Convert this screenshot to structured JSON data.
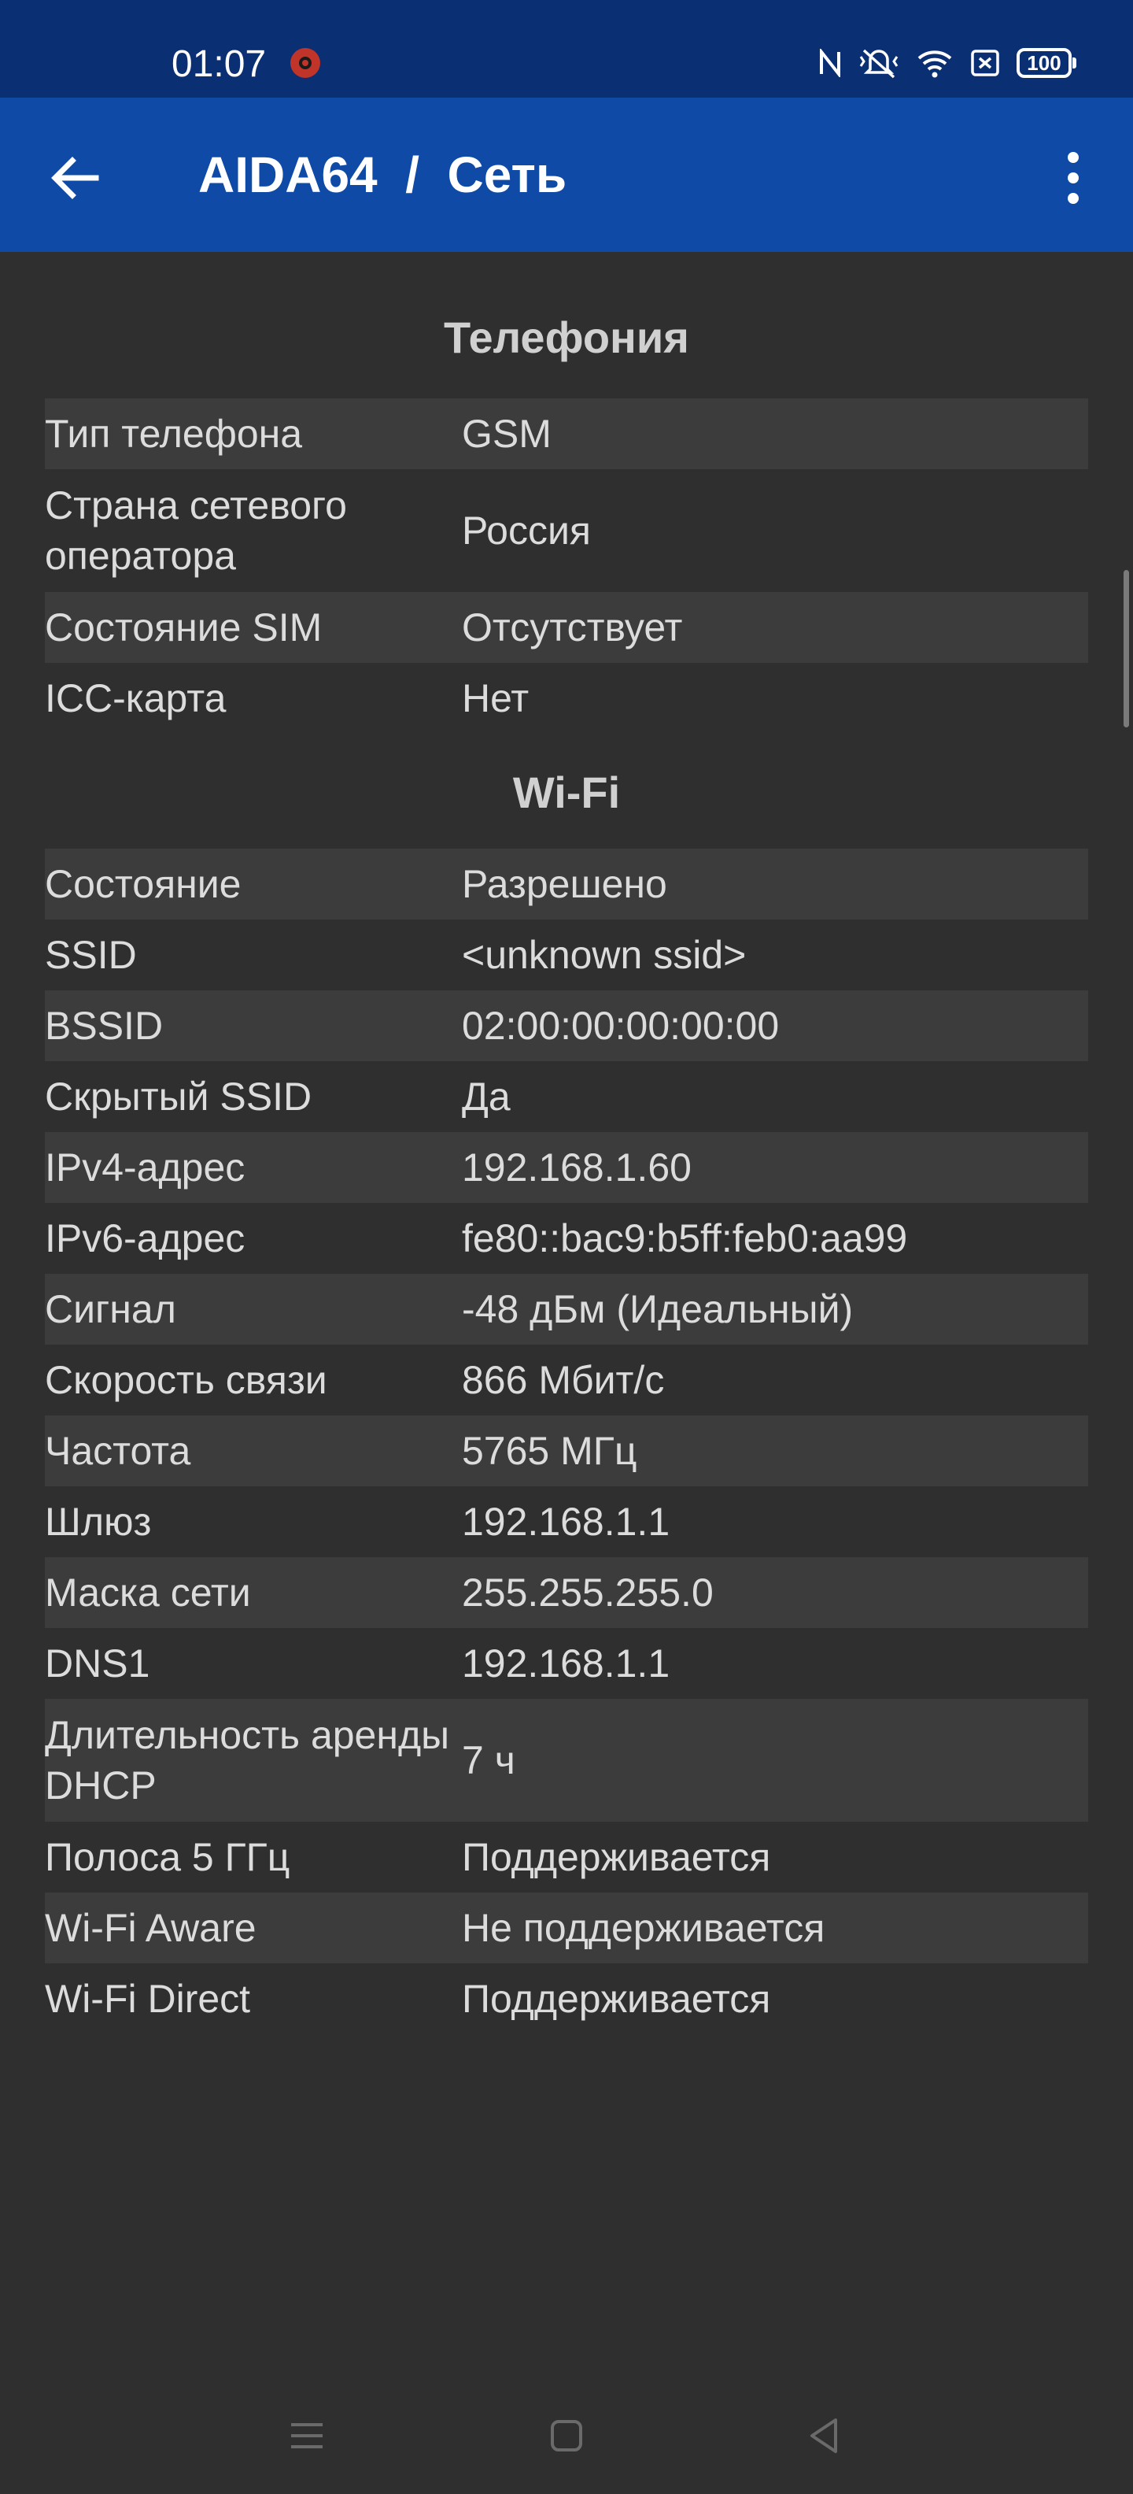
{
  "status_bar": {
    "time": "01:07",
    "icons": [
      "notification-app-icon",
      "nfc-icon",
      "mute-icon",
      "wifi-icon",
      "close-box-icon"
    ],
    "battery": "100"
  },
  "app_bar": {
    "title": "AIDA64  /  Сеть",
    "back_icon": "arrow-left-icon",
    "menu_icon": "more-vert-icon"
  },
  "telephony": {
    "title": "Телефония",
    "rows": [
      {
        "label": "Тип телефона",
        "value": "GSM"
      },
      {
        "label": "Страна сетевого оператора",
        "value": "Россия"
      },
      {
        "label": "Состояние SIM",
        "value": "Отсутствует"
      },
      {
        "label": "ICC-карта",
        "value": "Нет"
      }
    ]
  },
  "wifi": {
    "title": "Wi-Fi",
    "rows": [
      {
        "label": "Состояние",
        "value": "Разрешено"
      },
      {
        "label": "SSID",
        "value": "<unknown ssid>"
      },
      {
        "label": "BSSID",
        "value": "02:00:00:00:00:00"
      },
      {
        "label": "Скрытый SSID",
        "value": "Да"
      },
      {
        "label": "IPv4-адрес",
        "value": "192.168.1.60"
      },
      {
        "label": "IPv6-адрес",
        "value": "fe80::bac9:b5ff:feb0:aa99"
      },
      {
        "label": "Сигнал",
        "value": "-48 дБм (Идеальный)"
      },
      {
        "label": "Скорость связи",
        "value": "866 Мбит/с"
      },
      {
        "label": "Частота",
        "value": "5765 МГц"
      },
      {
        "label": "Шлюз",
        "value": "192.168.1.1"
      },
      {
        "label": "Маска сети",
        "value": "255.255.255.0"
      },
      {
        "label": "DNS1",
        "value": "192.168.1.1"
      },
      {
        "label": "Длительность аренды DHCP",
        "value": "7 ч"
      },
      {
        "label": "Полоса 5 ГГц",
        "value": "Поддерживается"
      },
      {
        "label": "Wi-Fi Aware",
        "value": "Не поддерживается"
      },
      {
        "label": "Wi-Fi Direct",
        "value": "Поддерживается"
      }
    ]
  },
  "nav_bar": {
    "icons": [
      "menu-lines-icon",
      "home-square-icon",
      "back-triangle-icon"
    ]
  },
  "colors": {
    "status_bar_bg": "#0b2f73",
    "app_bar_bg": "#0e4aa6",
    "content_bg": "#2f2f2f",
    "row_alt_bg": "#3c3c3c"
  }
}
